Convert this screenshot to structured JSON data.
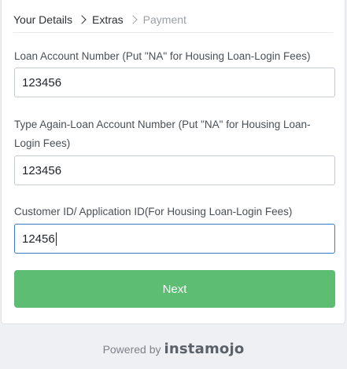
{
  "breadcrumb": {
    "items": [
      {
        "label": "Your Details",
        "state": "done"
      },
      {
        "label": "Extras",
        "state": "current"
      },
      {
        "label": "Payment",
        "state": "upcoming"
      }
    ]
  },
  "form": {
    "loan_account": {
      "label": "Loan Account Number (Put \"NA\" for Housing Loan-Login Fees)",
      "value": "123456"
    },
    "loan_account_confirm": {
      "label": "Type Again-Loan Account Number (Put \"NA\" for Housing Loan-Login Fees)",
      "value": "123456"
    },
    "customer_id": {
      "label": "Customer ID/ Application ID(For Housing Loan-Login Fees)",
      "value": "12456"
    },
    "next_label": "Next"
  },
  "footer": {
    "powered_by": "Powered by",
    "brand": "instamojo"
  },
  "colors": {
    "button": "#5cbd73",
    "focus_border": "#3b7bbf",
    "page_bg": "#eef0f3"
  }
}
